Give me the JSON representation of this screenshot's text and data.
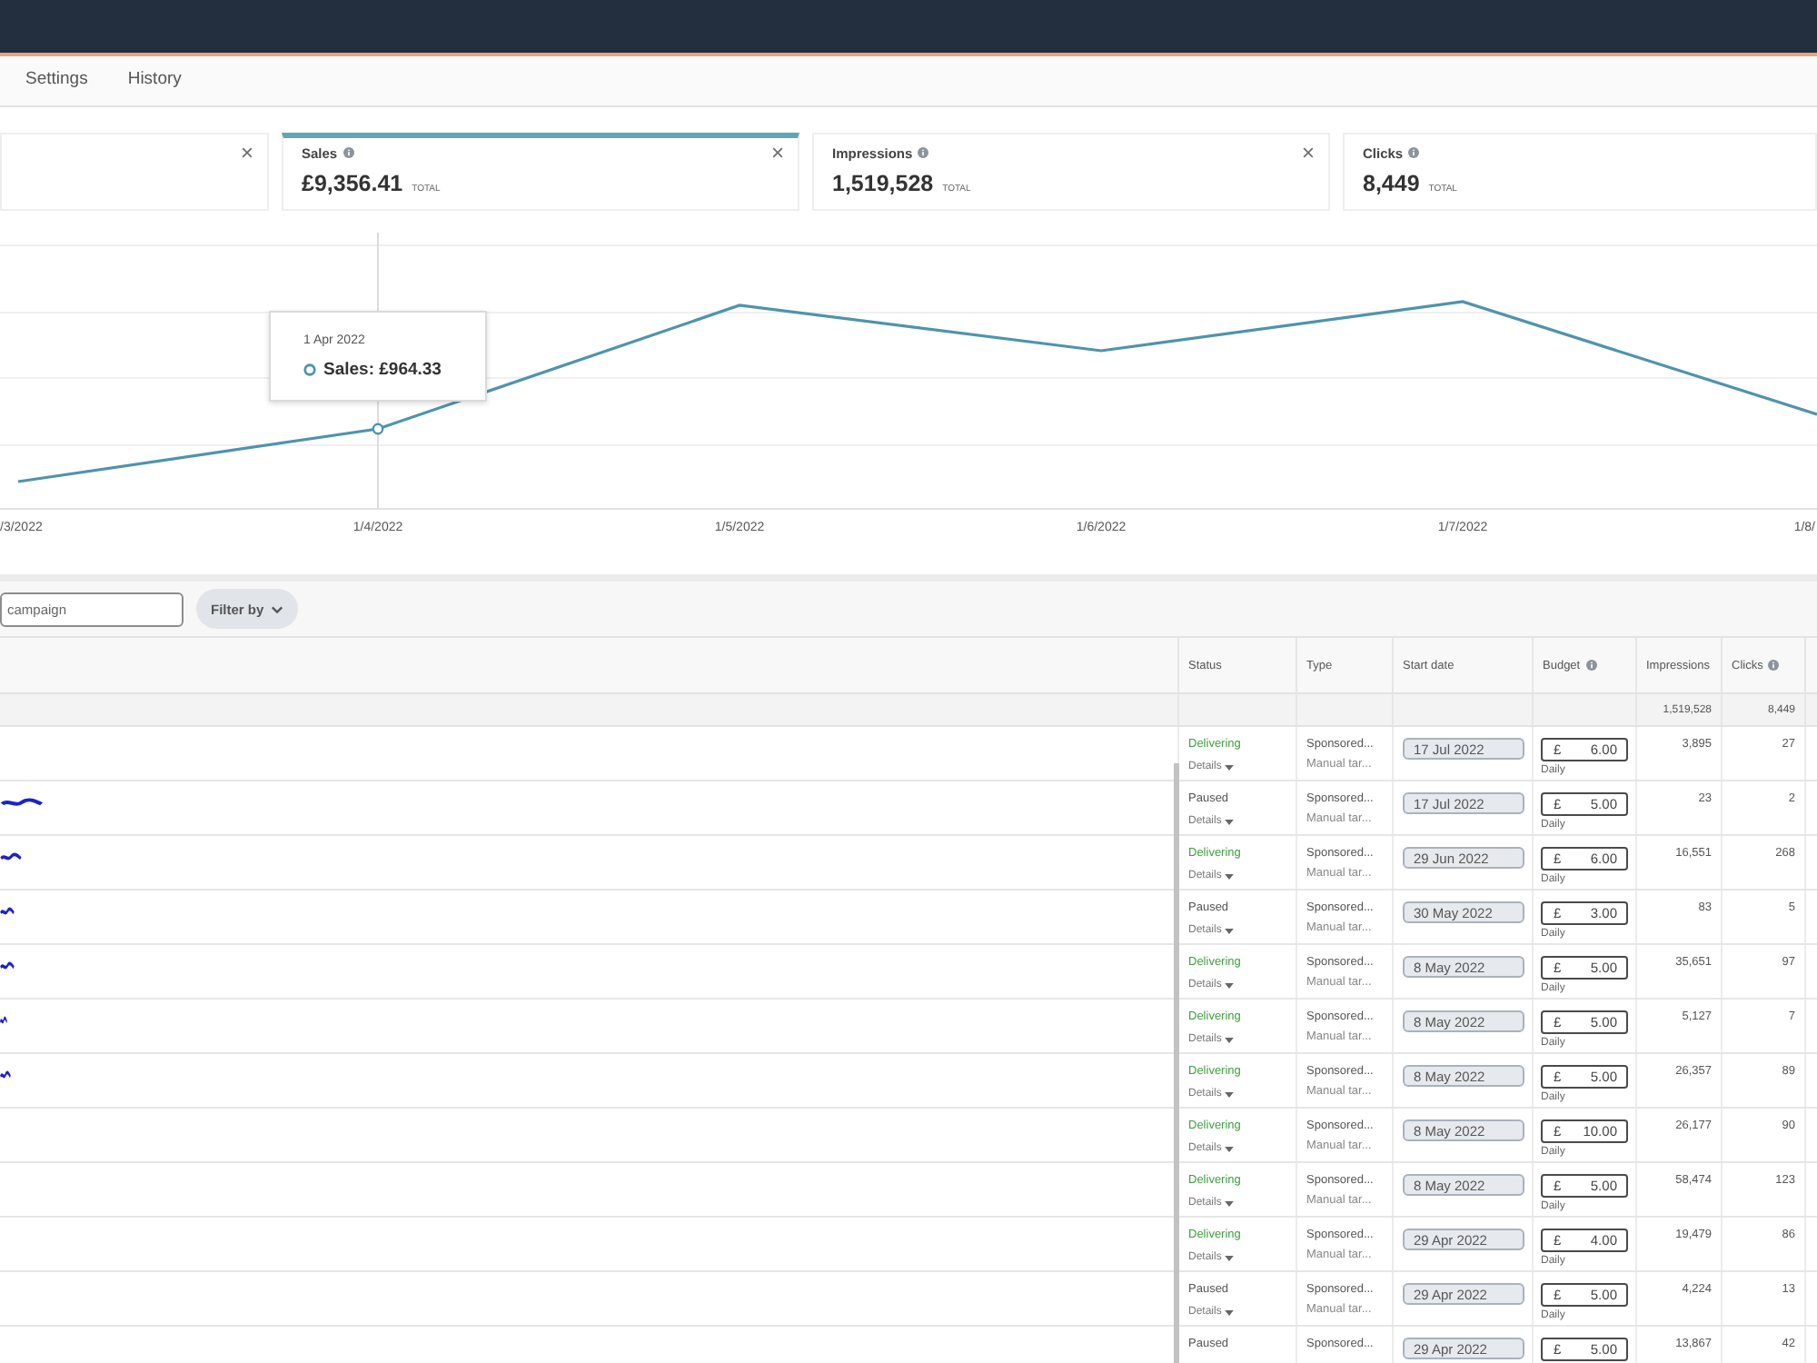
{
  "nav": {
    "tabs": [
      {
        "label": "Settings",
        "selected": false
      },
      {
        "label": "History",
        "selected": false
      }
    ]
  },
  "metrics": [
    {
      "closable": true,
      "selected": false
    },
    {
      "label": "Sales",
      "info": true,
      "value": "£9,356.41",
      "unit": "TOTAL",
      "closable": true,
      "selected": true
    },
    {
      "label": "Impressions",
      "info": true,
      "value": "1,519,528",
      "unit": "TOTAL",
      "closable": true,
      "selected": false
    },
    {
      "label": "Clicks",
      "info": true,
      "value": "8,449",
      "unit": "TOTAL",
      "closable": false,
      "selected": false
    }
  ],
  "chart": {
    "x_labels": [
      "/3/2022",
      "1/4/2022",
      "1/5/2022",
      "1/6/2022",
      "1/7/2022",
      "1/8/"
    ],
    "tooltip": {
      "date": "1 Apr 2022",
      "text": "Sales: £964.33"
    }
  },
  "filter": {
    "search": {
      "placeholder": "campaign"
    },
    "button": "Filter by"
  },
  "table": {
    "columns": [
      {
        "label": "Status",
        "info": false
      },
      {
        "label": "Type",
        "info": false
      },
      {
        "label": "Start date",
        "info": false
      },
      {
        "label": "Budget",
        "info": true
      },
      {
        "label": "Impressions",
        "info": false
      },
      {
        "label": "Clicks",
        "info": true
      }
    ],
    "totals": {
      "impressions": "1,519,528",
      "clicks": "8,449"
    },
    "rows": [
      {
        "redacted": false,
        "status": "Delivering",
        "active": true,
        "details": "Details",
        "type": "Sponsored...",
        "targeting": "Manual tar...",
        "start_date": "17 Jul 2022",
        "currency": "£",
        "budget": "6.00",
        "period": "Daily",
        "impressions": "3,895",
        "clicks": "27"
      },
      {
        "redacted": true,
        "status": "Paused",
        "active": false,
        "details": "Details",
        "type": "Sponsored...",
        "targeting": "Manual tar...",
        "start_date": "17 Jul 2022",
        "currency": "£",
        "budget": "5.00",
        "period": "Daily",
        "impressions": "23",
        "clicks": "2"
      },
      {
        "redacted": true,
        "status": "Delivering",
        "active": true,
        "details": "Details",
        "type": "Sponsored...",
        "targeting": "Manual tar...",
        "start_date": "29 Jun 2022",
        "currency": "£",
        "budget": "6.00",
        "period": "Daily",
        "impressions": "16,551",
        "clicks": "268"
      },
      {
        "redacted": true,
        "status": "Paused",
        "active": false,
        "details": "Details",
        "type": "Sponsored...",
        "targeting": "Manual tar...",
        "start_date": "30 May 2022",
        "currency": "£",
        "budget": "3.00",
        "period": "Daily",
        "impressions": "83",
        "clicks": "5"
      },
      {
        "redacted": true,
        "status": "Delivering",
        "active": true,
        "details": "Details",
        "type": "Sponsored...",
        "targeting": "Manual tar...",
        "start_date": "8 May 2022",
        "currency": "£",
        "budget": "5.00",
        "period": "Daily",
        "impressions": "35,651",
        "clicks": "97"
      },
      {
        "redacted": true,
        "status": "Delivering",
        "active": true,
        "details": "Details",
        "type": "Sponsored...",
        "targeting": "Manual tar...",
        "start_date": "8 May 2022",
        "currency": "£",
        "budget": "5.00",
        "period": "Daily",
        "impressions": "5,127",
        "clicks": "7"
      },
      {
        "redacted": true,
        "status": "Delivering",
        "active": true,
        "details": "Details",
        "type": "Sponsored...",
        "targeting": "Manual tar...",
        "start_date": "8 May 2022",
        "currency": "£",
        "budget": "5.00",
        "period": "Daily",
        "impressions": "26,357",
        "clicks": "89"
      },
      {
        "redacted": false,
        "status": "Delivering",
        "active": true,
        "details": "Details",
        "type": "Sponsored...",
        "targeting": "Manual tar...",
        "start_date": "8 May 2022",
        "currency": "£",
        "budget": "10.00",
        "period": "Daily",
        "impressions": "26,177",
        "clicks": "90"
      },
      {
        "redacted": false,
        "status": "Delivering",
        "active": true,
        "details": "Details",
        "type": "Sponsored...",
        "targeting": "Manual tar...",
        "start_date": "8 May 2022",
        "currency": "£",
        "budget": "5.00",
        "period": "Daily",
        "impressions": "58,474",
        "clicks": "123"
      },
      {
        "redacted": false,
        "status": "Delivering",
        "active": true,
        "details": "Details",
        "type": "Sponsored...",
        "targeting": "Manual tar...",
        "start_date": "29 Apr 2022",
        "currency": "£",
        "budget": "4.00",
        "period": "Daily",
        "impressions": "19,479",
        "clicks": "86"
      },
      {
        "redacted": false,
        "status": "Paused",
        "active": false,
        "details": "Details",
        "type": "Sponsored...",
        "targeting": "Manual tar...",
        "start_date": "29 Apr 2022",
        "currency": "£",
        "budget": "5.00",
        "period": "Daily",
        "impressions": "4,224",
        "clicks": "13"
      },
      {
        "redacted": false,
        "status": "Paused",
        "active": false,
        "type": "Sponsored...",
        "start_date": "29 Apr 2022",
        "currency": "£",
        "budget": "5.00",
        "impressions": "13,867",
        "clicks": "42"
      }
    ]
  }
}
